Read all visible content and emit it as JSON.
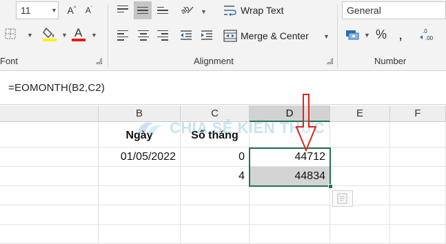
{
  "ribbon": {
    "font_size": "11",
    "font_group_label": "Font",
    "alignment_group_label": "Alignment",
    "number_group_label": "Number",
    "wrap_text_label": "Wrap Text",
    "merge_center_label": "Merge & Center",
    "number_format": "General",
    "font_color_bar": "#e8191b",
    "fill_color_bar": "#f5f500"
  },
  "formula_bar": {
    "formula": "=EOMONTH(B2,C2)"
  },
  "grid": {
    "columns": [
      "B",
      "C",
      "D",
      "E",
      "F"
    ],
    "active_column": "D",
    "header_row": {
      "B": "Ngày",
      "C": "Số tháng"
    },
    "rows": [
      {
        "B": "01/05/2022",
        "C": "0",
        "D": "44712"
      },
      {
        "B": "",
        "C": "4",
        "D": "44834"
      }
    ],
    "accent_color": "#217346",
    "arrow_color": "#e0231d"
  },
  "watermark": {
    "text": "CHIA SẺ KIẾN THỨC"
  }
}
